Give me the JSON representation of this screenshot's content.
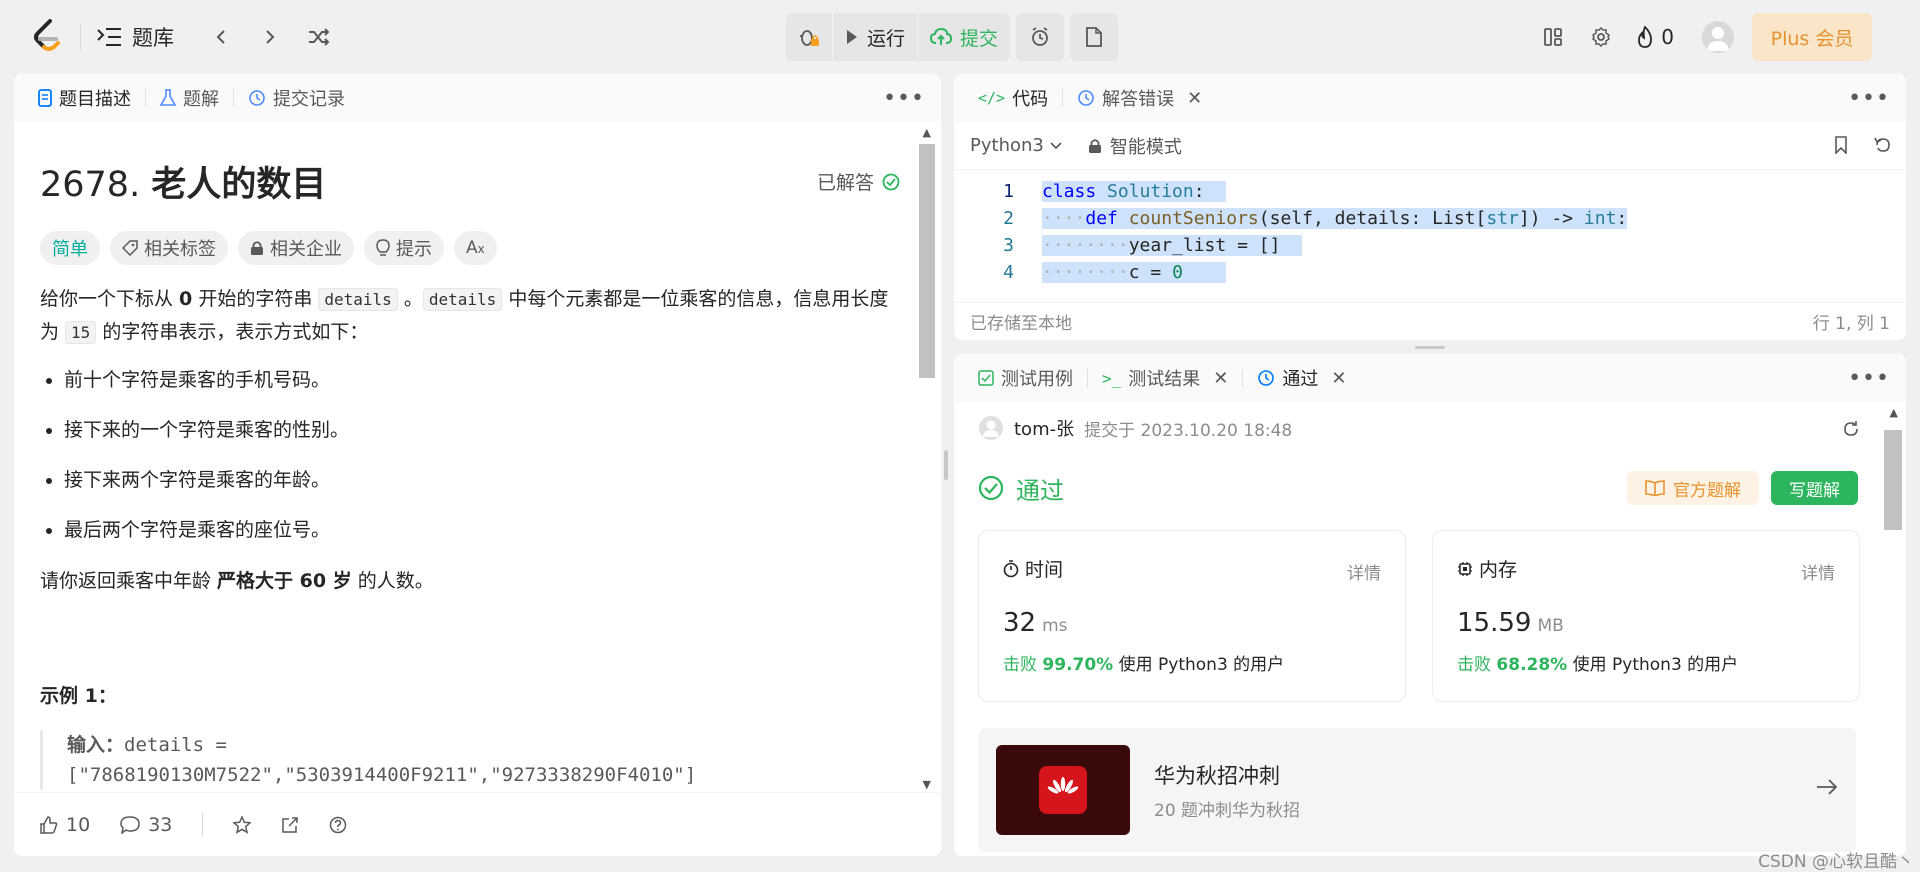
{
  "topbar": {
    "problem_list": "题库",
    "run": "运行",
    "submit": "提交",
    "fire_count": "0",
    "plus": "Plus 会员"
  },
  "left": {
    "tabs": [
      "题目描述",
      "题解",
      "提交记录"
    ],
    "title_num": "2678.",
    "title_name": "老人的数目",
    "solved": "已解答",
    "chips": [
      "简单",
      "相关标签",
      "相关企业",
      "提示"
    ],
    "p1_a": "给你一个下标从 ",
    "p1_b": "0",
    "p1_c": " 开始的字符串 ",
    "p1_code1": "details",
    "p1_d": " 。",
    "p1_code2": "details",
    "p1_e": " 中每个元素都是一位乘客的信息，信息用长度为 ",
    "p1_code3": "15",
    "p1_f": " 的字符串表示，表示方式如下：",
    "bullets": [
      "前十个字符是乘客的手机号码。",
      "接下来的一个字符是乘客的性别。",
      "接下来两个字符是乘客的年龄。",
      "最后两个字符是乘客的座位号。"
    ],
    "p2_a": "请你返回乘客中年龄 ",
    "p2_b": "严格大于 60 岁",
    "p2_c": " 的人数。",
    "example_title": "示例 1：",
    "example_label": "输入：",
    "example_line1": "details =",
    "example_line2": "[\"7868190130M7522\",\"5303914400F9211\",\"9273338290F4010\"]",
    "likes": "10",
    "comments": "33"
  },
  "code": {
    "tabs": [
      "代码",
      "解答错误"
    ],
    "lang": "Python3",
    "mode": "智能模式",
    "lines": [
      {
        "n": "1",
        "text": "class Solution:"
      },
      {
        "n": "2",
        "text": "    def countSeniors(self, details: List[str]) -> int:"
      },
      {
        "n": "3",
        "text": "        year_list = []"
      },
      {
        "n": "4",
        "text": "        c = 0"
      }
    ],
    "saved": "已存储至本地",
    "cursor": "行 1, 列 1"
  },
  "result": {
    "tabs": [
      "测试用例",
      "测试结果",
      "通过"
    ],
    "user": "tom-张",
    "submitted_at": "提交于 2023.10.20 18:48",
    "status": "通过",
    "official": "官方题解",
    "write": "写题解",
    "time_label": "时间",
    "time_value": "32",
    "time_unit": "ms",
    "time_beat_label": "击败",
    "time_beat": "99.70%",
    "time_beat_suffix": "使用 Python3 的用户",
    "mem_label": "内存",
    "mem_value": "15.59",
    "mem_unit": "MB",
    "mem_beat_label": "击败",
    "mem_beat": "68.28%",
    "mem_beat_suffix": "使用 Python3 的用户",
    "detail": "详情",
    "promo_title": "华为秋招冲刺",
    "promo_sub": "20 题冲刺华为秋招"
  },
  "watermark": "CSDN @心软且酷丶",
  "colors": {
    "green": "#2db55d",
    "orange": "#e6932e",
    "easy": "#00af9b",
    "selection": "#cfe2fb"
  }
}
